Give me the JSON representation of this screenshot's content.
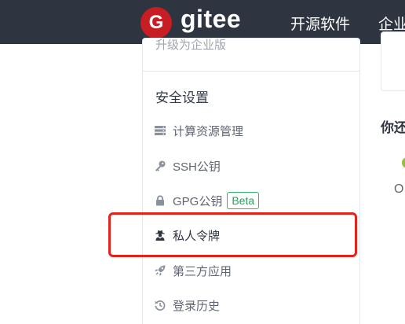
{
  "header": {
    "logo_letter": "G",
    "logo_text": "gitee",
    "nav": [
      "开源软件",
      "企业"
    ]
  },
  "sidebar": {
    "partial_item": "升级为企业版",
    "section_title": "安全设置",
    "items": [
      {
        "label": "计算资源管理",
        "icon": "server-icon"
      },
      {
        "label": "SSH公钥",
        "icon": "key-icon"
      },
      {
        "label": "GPG公钥",
        "icon": "lock-icon",
        "badge": "Beta"
      },
      {
        "label": "私人令牌",
        "icon": "user-secret-icon",
        "highlighted": true
      },
      {
        "label": "第三方应用",
        "icon": "rocket-icon"
      },
      {
        "label": "登录历史",
        "icon": "history-icon"
      }
    ]
  },
  "right_panel": {
    "heading": "你还",
    "text": "O"
  },
  "colors": {
    "header_bg": "#2f3441",
    "brand_red": "#c71d23",
    "badge_green": "#21a35c",
    "highlight_red": "#e8201a"
  }
}
